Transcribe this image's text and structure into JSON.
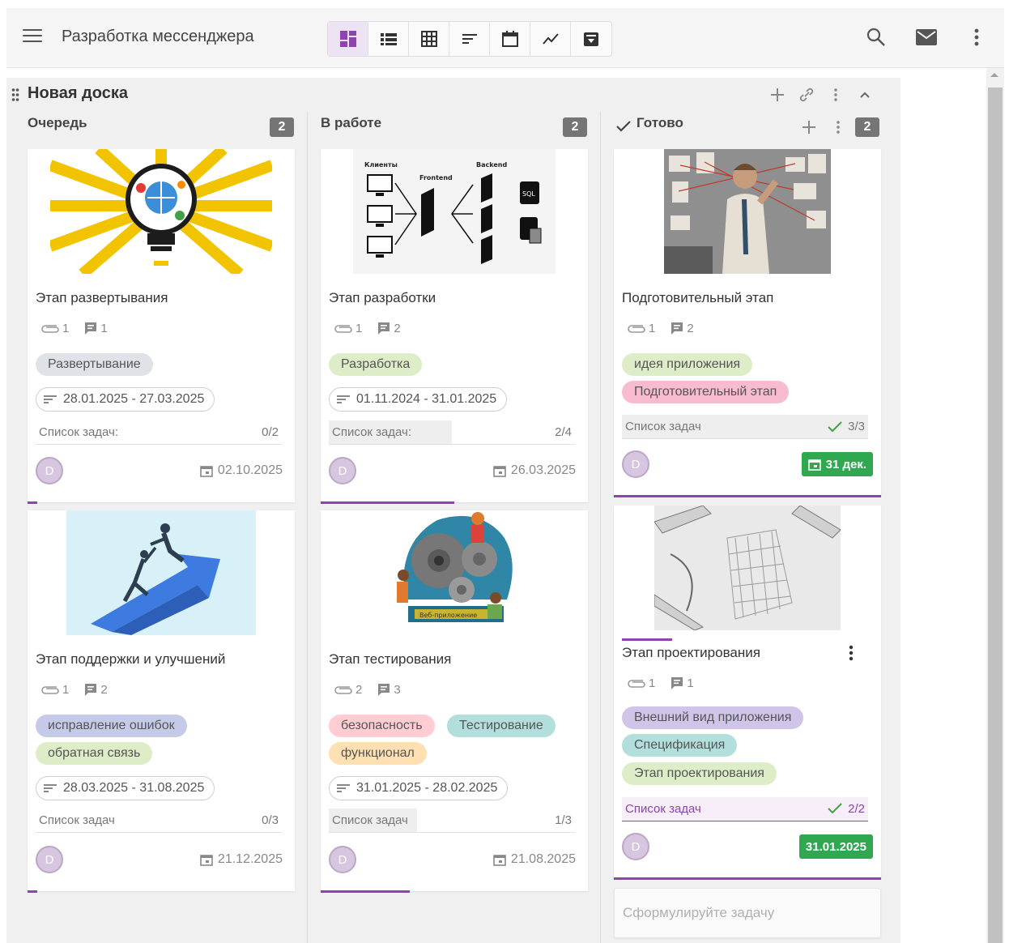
{
  "app": {
    "title": "Разработка мессенджера"
  },
  "board": {
    "title": "Новая доска"
  },
  "columns": [
    {
      "title": "Очередь",
      "count": "2"
    },
    {
      "title": "В работе",
      "count": "2"
    },
    {
      "title": "Готово",
      "count": "2"
    }
  ],
  "cards": {
    "c1": {
      "title": "Этап развертывания",
      "attachments": "1",
      "comments": "1",
      "tags": [
        "Развертывание"
      ],
      "dates": "28.01.2025 - 27.03.2025",
      "tasks_label": "Список задач:",
      "tasks_count": "0/2",
      "task_progress": 0.0,
      "avatar": "D",
      "due": "02.10.2025",
      "line_progress": 0.04
    },
    "c2": {
      "title": "Этап поддержки и улучшений",
      "attachments": "1",
      "comments": "2",
      "tags": [
        "исправление ошибок",
        "обратная связь"
      ],
      "dates": "28.03.2025 - 31.08.2025",
      "tasks_label": "Список задач",
      "tasks_count": "0/3",
      "task_progress": 0.0,
      "avatar": "D",
      "due": "21.12.2025",
      "line_progress": 0.04
    },
    "c3": {
      "title": "Этап разработки",
      "attachments": "1",
      "comments": "2",
      "tags": [
        "Разработка"
      ],
      "dates": "01.11.2024 - 31.01.2025",
      "tasks_label": "Список задач:",
      "tasks_count": "2/4",
      "task_progress": 0.5,
      "avatar": "D",
      "due": "26.03.2025",
      "line_progress": 0.5
    },
    "c4": {
      "title": "Этап тестирования",
      "attachments": "2",
      "comments": "3",
      "tags": [
        "безопасность",
        "Тестирование",
        "функционал"
      ],
      "dates": "31.01.2025 - 28.02.2025",
      "tasks_label": "Список задач",
      "tasks_count": "1/3",
      "task_progress": 0.33,
      "avatar": "D",
      "due": "21.08.2025",
      "line_progress": 0.33
    },
    "c5": {
      "title": "Подготовительный этап",
      "attachments": "1",
      "comments": "2",
      "tags": [
        "идея приложения",
        "Подготовительный этап"
      ],
      "tasks_label": "Список задач",
      "tasks_count": "3/3",
      "task_progress": 1.0,
      "avatar": "D",
      "due": "31 дек.",
      "line_progress": 1.0
    },
    "c6": {
      "title": "Этап проектирования",
      "attachments": "1",
      "comments": "1",
      "tags": [
        "Внешний вид приложения",
        "Спецификация",
        "Этап проектирования"
      ],
      "tasks_label": "Список задач",
      "tasks_count": "2/2",
      "task_progress": 1.0,
      "avatar": "D",
      "due": "31.01.2025",
      "line_progress": 1.0
    }
  },
  "new_task_placeholder": "Сформулируйте задачу",
  "image_labels": {
    "diagram_clients": "Клиенты",
    "diagram_frontend": "Frontend",
    "diagram_backend": "Backend",
    "diagram_sql": "SQL",
    "testing_banner": "Веб-приложение"
  },
  "colors": {
    "accent": "#8e44ad",
    "badge": "#757575",
    "due_done": "#2fa84f",
    "tag_gray": "#dfe3e8",
    "tag_green": "#dcedc8",
    "tag_blue": "#c5cae9",
    "tag_pink": "#f8bbd0",
    "tag_red": "#ffcdd2",
    "tag_teal": "#b2dfdb",
    "tag_orange": "#ffe0b2",
    "tag_purple": "#d1c4e9"
  },
  "icons": {
    "menu": "menu-icon",
    "dashboard": "dashboard-icon",
    "list": "list-icon",
    "grid": "grid-icon",
    "sort": "sort-icon",
    "calendar": "calendar-icon",
    "chart": "chart-icon",
    "archive": "archive-icon",
    "search": "search-icon",
    "mail": "mail-icon",
    "more": "more-vert-icon"
  }
}
